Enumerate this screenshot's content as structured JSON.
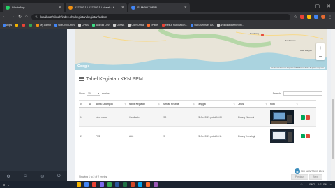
{
  "browser": {
    "tabs": [
      {
        "label": "WhatsApp",
        "color": "#25d366"
      },
      {
        "label": "127.0.0.1 / 127.0.0.1 / siksah / k...",
        "color": "#f29111"
      },
      {
        "label": "SI MONITORIN",
        "color": "#4285f4"
      }
    ],
    "new_tab": "+",
    "window_controls": [
      "–",
      "▢",
      "✕"
    ],
    "url": "localhost/siksah/index.php/kegiatan/kegiatan/admin",
    "bookmarks": [
      "Apps",
      "My Admin",
      "SIMONITORIN",
      "CPNS",
      "Android Dev",
      "CPANL",
      "Client Area",
      "cPanel",
      "Res & Publication...",
      "UAS Semster 8A",
      "androidzone/fileinfo..."
    ]
  },
  "map": {
    "labels": [
      "Kembang",
      "Kota Bonyuh",
      "Bondowoso"
    ],
    "google_mark": "Google",
    "footer": "Keyboard shortcuts  Map data ©2021  Terms of Use  Report a map error"
  },
  "card": {
    "title": "Tabel Kegiatan KKN PPM",
    "show_label": "Show",
    "show_value": "10",
    "entries_label": "entries",
    "search_label": "Search:",
    "columns": [
      "#",
      "ID",
      "Nama Kelompok",
      "Nama Kegiatan",
      "Jumlah Peserta",
      "Tanggal",
      "Jenis",
      "Foto",
      ""
    ],
    "rows": [
      {
        "no": "1",
        "id": "",
        "kelompok": "mina maria",
        "kegiatan": "Handbadx",
        "peserta": "200",
        "tanggal": "22 Jun 2021 pukul 14:00",
        "jenis": "Bidang Ekonomi"
      },
      {
        "no": "2",
        "id": "",
        "kelompok": "PMD",
        "kegiatan": "Adis",
        "peserta": "20",
        "tanggal": "22 Jun 2021 pukul 14:11",
        "jenis": "Bidang Teknologi"
      }
    ],
    "info": "Showing 1 to 2 of 2 entries",
    "previous": "Previous",
    "next": "Next"
  },
  "footer_badge": "SIX MONITORIN 2021",
  "tray": {
    "lang": "ENG",
    "time": "1:01 PM"
  },
  "colors": {
    "edit": "#00a65a",
    "delete": "#dd4b39",
    "sidebar": "#2b333e"
  }
}
